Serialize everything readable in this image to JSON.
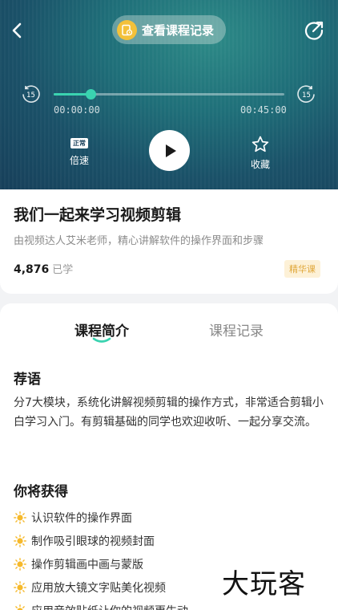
{
  "player": {
    "record_button_label": "查看课程记录",
    "rewind_seconds": "15",
    "forward_seconds": "15",
    "current_time": "00:00:00",
    "total_time": "00:45:00",
    "progress": 0.16,
    "speed_badge": "正常",
    "speed_label": "倍速",
    "favorite_label": "收藏",
    "accent_color": "#3ad3b0"
  },
  "course": {
    "title": "我们一起来学习视频剪辑",
    "description": "由视频达人艾米老师，精心讲解软件的操作界面和步骤",
    "learned_count": "4,876",
    "learned_unit": "已学",
    "badge": "精华课"
  },
  "tabs": [
    {
      "label": "课程简介",
      "active": true
    },
    {
      "label": "课程记录",
      "active": false
    }
  ],
  "intro": {
    "recommend_title": "荐语",
    "recommend_text": "分7大模块，系统化讲解视频剪辑的操作方式，非常适合剪辑小白学习入门。有剪辑基础的同学也欢迎收听、一起分享交流。",
    "gain_title": "你将获得",
    "gains": [
      "认识软件的操作界面",
      "制作吸引眼球的视频封面",
      "操作剪辑画中画与蒙版",
      "应用放大镜文字贴美化视频",
      "应用音效贴纸让你的视频更生动"
    ]
  },
  "watermark": "大玩客"
}
